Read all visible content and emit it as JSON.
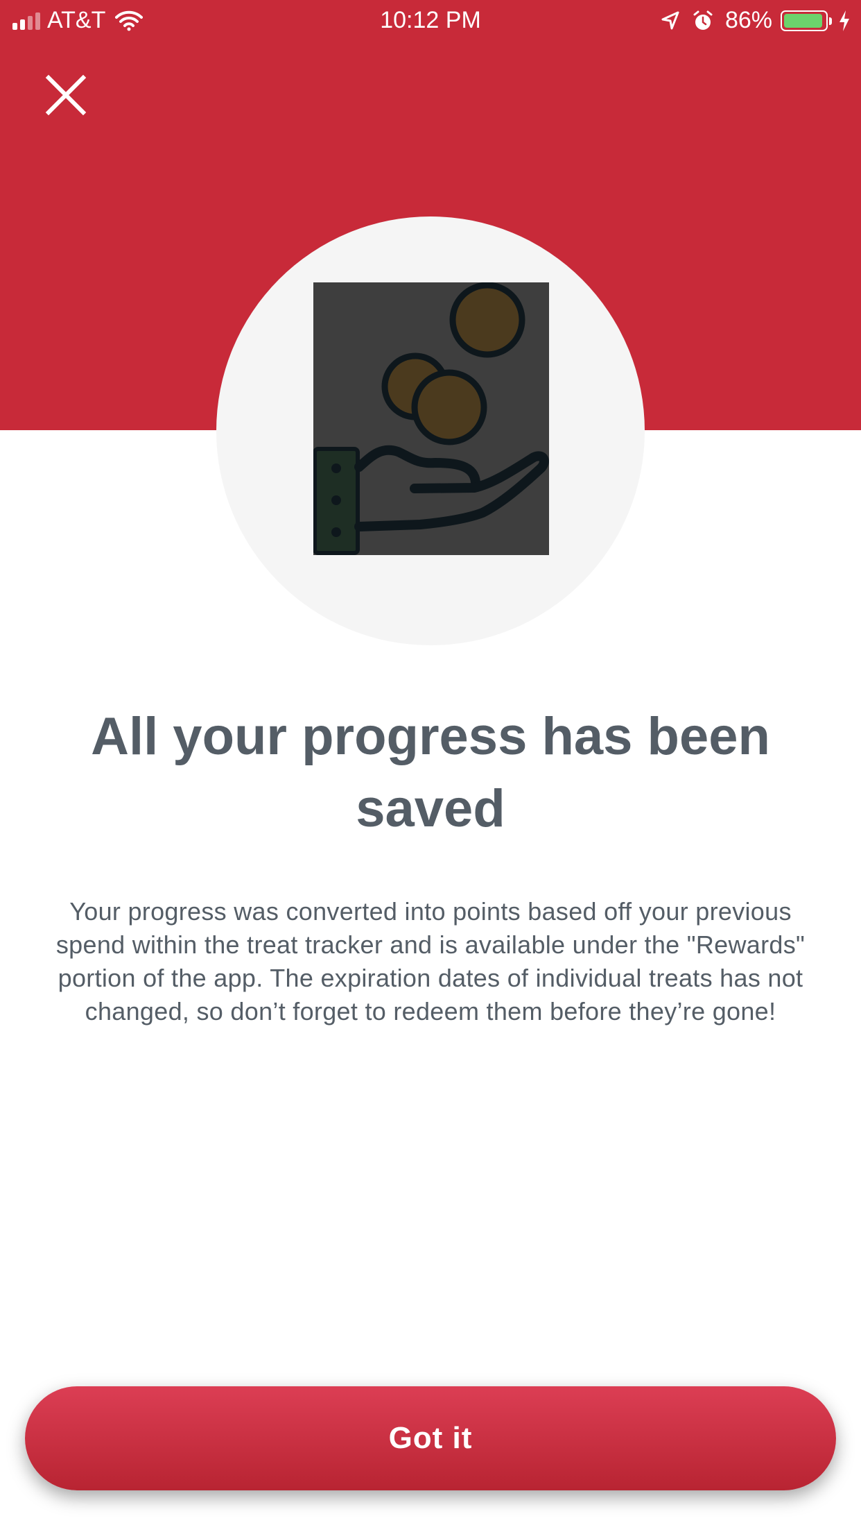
{
  "status_bar": {
    "carrier": "AT&T",
    "time": "10:12 PM",
    "battery_percent": "86%",
    "battery_level": 0.86,
    "icons": [
      "signal-icon",
      "wifi-icon",
      "location-icon",
      "alarm-icon",
      "battery-icon",
      "charging-icon"
    ]
  },
  "header": {
    "close_icon": "close-icon",
    "background_color": "#c82a39"
  },
  "illustration": {
    "icon": "hand-with-coins-icon"
  },
  "content": {
    "title": "All your progress has been saved",
    "body": "Your progress was converted into points based off your previous spend within the treat tracker and is available under the \"Rewards\" portion of the app. The expiration dates of individual treats has not changed, so don’t forget to redeem them before they’re gone!"
  },
  "actions": {
    "primary_label": "Got it",
    "primary_color": "#c82a39"
  }
}
